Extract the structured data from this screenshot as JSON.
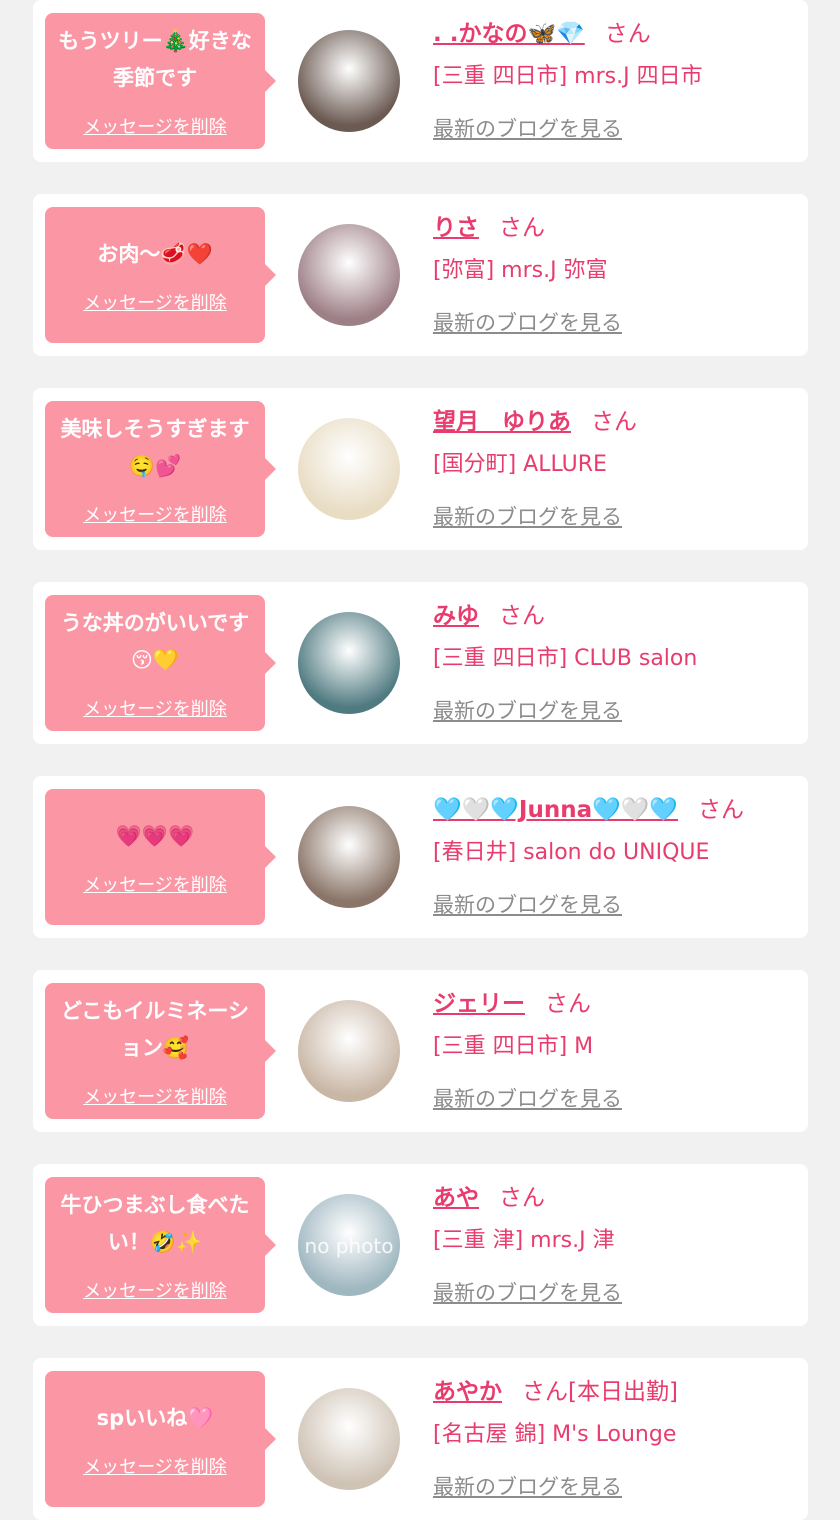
{
  "messages": [
    {
      "message": "もうツリー🎄好きな季節です",
      "delete_label": "メッセージを削除",
      "name": ". .かなの🦋💎",
      "honorific": "さん",
      "shop": "[三重 四日市] mrs.J 四日市",
      "blog_link": "最新のブログを見る",
      "avatar_color": "#6b5a52"
    },
    {
      "message": "お肉〜🥩❤️",
      "delete_label": "メッセージを削除",
      "name": "りさ",
      "honorific": "さん",
      "shop": "[弥富] mrs.J 弥富",
      "blog_link": "最新のブログを見る",
      "avatar_color": "#9d7f86"
    },
    {
      "message": "美味しそうすぎます🤤💕",
      "delete_label": "メッセージを削除",
      "name": "望月　ゆりあ",
      "honorific": "さん",
      "shop": "[国分町] ALLURE",
      "blog_link": "最新のブログを見る",
      "avatar_color": "#e8dcc3"
    },
    {
      "message": "うな丼のがいいです😚💛",
      "delete_label": "メッセージを削除",
      "name": "みゆ",
      "honorific": "さん",
      "shop": "[三重 四日市] CLUB salon",
      "blog_link": "最新のブログを見る",
      "avatar_color": "#4f7a80"
    },
    {
      "message": "💗💗💗",
      "delete_label": "メッセージを削除",
      "name": "🩵🤍🩵Junna🩵🤍🩵",
      "honorific": "さん",
      "shop": "[春日井] salon do UNIQUE",
      "blog_link": "最新のブログを見る",
      "avatar_color": "#8a7568"
    },
    {
      "message": "どこもイルミネーション🥰",
      "delete_label": "メッセージを削除",
      "name": "ジェリー",
      "honorific": "さん",
      "shop": "[三重 四日市] M",
      "blog_link": "最新のブログを見る",
      "avatar_color": "#c9b7a6"
    },
    {
      "message": "牛ひつまぶし食べたい！🤣✨",
      "delete_label": "メッセージを削除",
      "name": "あや",
      "honorific": "さん",
      "shop": "[三重 津] mrs.J 津",
      "blog_link": "最新のブログを見る",
      "avatar_color": "#9fb7c0",
      "avatar_text": "no photo"
    },
    {
      "message": "spいいね🩷",
      "delete_label": "メッセージを削除",
      "name": "あやか",
      "honorific": "さん[本日出勤]",
      "shop": "[名古屋 錦] M's Lounge",
      "blog_link": "最新のブログを見る",
      "avatar_color": "#cfc3b5"
    }
  ]
}
